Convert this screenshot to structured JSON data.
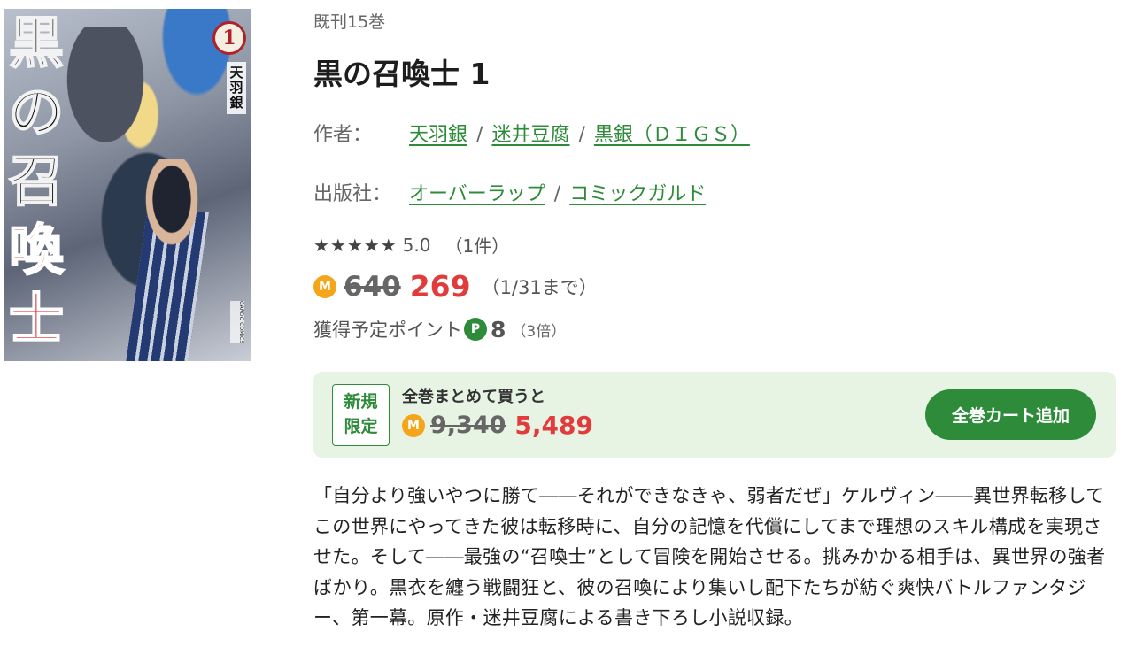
{
  "cover": {
    "title_chars": [
      "黒",
      "の",
      "召",
      "喚",
      "士"
    ],
    "volume_badge": "1",
    "author_chars": [
      "天",
      "羽",
      "銀"
    ],
    "imprint": "GARDO COMICS"
  },
  "series_count": "既刊15巻",
  "title": "黒の召喚士 1",
  "author": {
    "label": "作者：",
    "names": [
      "天羽銀",
      "迷井豆腐",
      "黒銀（ＤＩＧＳ）"
    ],
    "separator": "/"
  },
  "publisher": {
    "label": "出版社：",
    "names": [
      "オーバーラップ",
      "コミックガルド"
    ],
    "separator": "/"
  },
  "rating": {
    "stars": "★★★★★",
    "score": "5.0",
    "count": "（1件）"
  },
  "price": {
    "coin_icon": "M",
    "original": "640",
    "sale": "269",
    "until": "（1/31まで）"
  },
  "points": {
    "label": "獲得予定ポイント",
    "icon": "P",
    "value": "8",
    "multiplier": "（3倍）"
  },
  "bulk": {
    "badge_line1": "新規",
    "badge_line2": "限定",
    "label": "全巻まとめて買うと",
    "coin_icon": "M",
    "original": "9,340",
    "sale": "5,489",
    "button": "全巻カート追加"
  },
  "description": "「自分より強いやつに勝て――それができなきゃ、弱者だぜ」ケルヴィン――異世界転移してこの世界にやってきた彼は転移時に、自分の記憶を代償にしてまで理想のスキル構成を実現させた。そして――最強の“召喚士”として冒険を開始させる。挑みかかる相手は、異世界の強者ばかり。黒衣を纏う戦闘狂と、彼の召喚により集いし配下たちが紡ぐ爽快バトルファンタジー、第一幕。原作・迷井豆腐による書き下ろし小説収録。",
  "colors": {
    "accent_green": "#2e8b3a",
    "sale_red": "#e23b3b",
    "coin_orange": "#f5a51a",
    "bulk_bg": "#e7f4e4"
  }
}
